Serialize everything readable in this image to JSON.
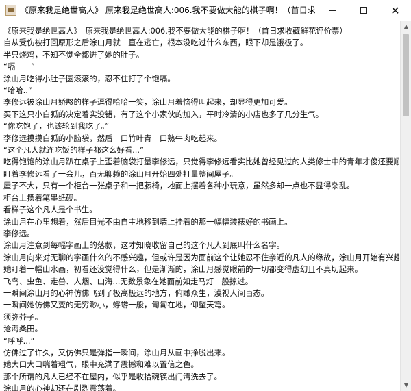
{
  "window": {
    "title": "《原来我是绝世高人》　原来我是绝世高人:006.我不要做大能的棋子啊！（首日求收藏鲜花评价票）",
    "title_visible": "《原来我是绝世高人》 原来我是绝世高人:006.我不要做大能的棋子啊！（首日求..."
  },
  "controls": {
    "minimize": "—",
    "maximize": "☐",
    "close": "✕"
  },
  "scrollbar": {
    "up": "▲",
    "down": "▼",
    "position": 0.0
  },
  "text_lines": [
    "《原来我是绝世高人》　原来我是绝世高人:006.我不要做大能的棋子啊！（首日求收藏鲜花评价票）",
    "自从受伤被打回原形之后涂山月就一直在逃亡，根本没吃过什么东西，眼下却是饿极了。",
    "半只烧鸡，不知不觉全都进了她的肚子。",
    "“嗝一一”",
    "涂山月吃得小肚子圆滚滚的，忍不住打了个饱嗝。",
    "“哈哈..”",
    "李修远被涂山月娇憨的样子逗得哈哈一笑，涂山月羞恼得叫起来，却显得更加可爱。",
    "买下这只小白狐的决定着实没错，有了这个小家伙的加入，平时冷清的小店也多了几分生气。",
    "“你吃饱了，也该轮到我吃了。”",
    "李修远摸摸白狐的小脑袋，然后一口竹叶青一口熟牛肉吃起来。",
    "“这个凡人就连吃饭的样子都这么好看...”",
    "吃得饱饱的涂山月趴在桌子上歪着脑袋打量李修远，只觉得李修远看实比她曾经见过的人类修士中的青年才俊还要顺眼许多，尤其是他身上的那种独特的气质，尔然前所未见的。",
    "盯着李修远看了一会儿，百无聊赖的涂山月开始四处打量整间屋子。",
    "屋子不大，只有一个柜台一张桌子和一把藤椅，地面上摆着各种小玩意，虽然多却一点也不显得杂乱。",
    "柜台上摆着笔墨纸砚。",
    "看样子这个凡人是个书生。",
    "涂山月在心里想着，然后目光不由自主地移到墙上挂着的那一幅幅装裱好的书画上。",
    "李修远。",
    "涂山月注意到每幅字画上的落款，这才知晓收留自己的这个凡人到底叫什么名字。",
    "涂山月向来对无聊的字画什么的不感兴趣，但或许是因为面前这个让她忍不住亲近的凡人的缘故，涂山月开始有兴趣仔细端详起那些字画起来。",
    "她盯着一幅山水画，初看还没觉得什么，但是渐渐的，涂山月感觉眼前的一切都变得虚幻且不真切起来。",
    "飞鸟、虫鱼、走兽、人烟、山海...无数景象在她面前如走马灯一般掠过。",
    "一瞬间涂山月的心神仿佛飞到了极高极远的地方，俯瞰众生，漠视人间百态。",
    "一瞬间她仿佛又变的无穷渺小，蜉蝣一般，匍匐在地，仰望天穹。",
    "须弥芥子。",
    "沧海桑田。",
    "“呼呼...”",
    "仿佛过了许久，又仿佛只是弹指一瞬间，涂山月从画中挣脱出来。",
    "她大口大口喘着粗气，眼中充满了震撼和难以置信之色。",
    "那个所谓的凡人已经不在屋内，似乎是收拾碗筷出门清洗去了。",
    "涂山月的心神却还在剧烈震荡着。",
    "她刚刚到底看到了什么？"
  ]
}
